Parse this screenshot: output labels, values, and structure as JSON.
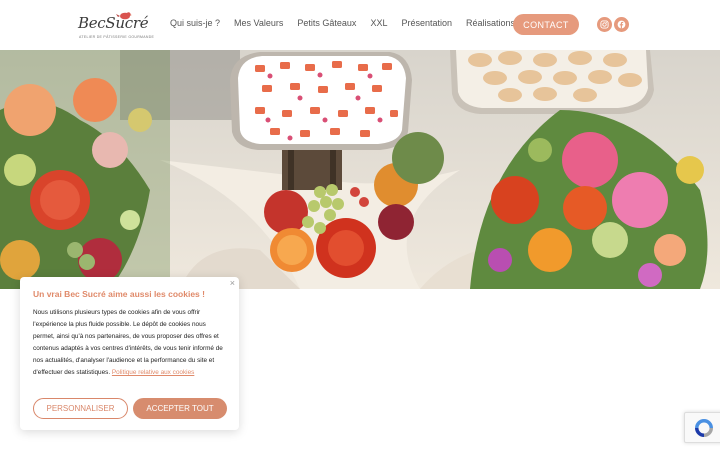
{
  "brand": {
    "name": "BecSucré",
    "tagline": "ATELIER DE PÂTISSERIE GOURMANDE"
  },
  "nav": {
    "items": [
      "Qui suis-je ?",
      "Mes Valeurs",
      "Petits Gâteaux",
      "XXL",
      "Présentation",
      "Réalisations"
    ],
    "contact_label": "CONTACT"
  },
  "social": {
    "icons": [
      "instagram-icon",
      "facebook-icon"
    ]
  },
  "hero": {
    "image": "photo-of-dessert-table-with-flowers"
  },
  "cookie": {
    "close_glyph": "×",
    "title": "Un vrai Bec Sucré aime aussi les cookies !",
    "text": "Nous utilisons plusieurs types de cookies afin de vous offrir l'expérience la plus fluide possible. Le dépôt de cookies nous permet, ainsi qu'à nos partenaires, de vous proposer des offres et contenus adaptés à vos centres d'intérêts, de vous tenir informé de nos actualités, d'analyser l'audience et la performance du site et d'effectuer des statistiques.",
    "link_label": "Politique relative aux cookies",
    "personalize_label": "PERSONNALISER",
    "accept_label": "ACCEPTER TOUT"
  },
  "colors": {
    "accent": "#e69a7d",
    "accent_dark": "#d78c6e",
    "title_color": "#e08a6a"
  }
}
